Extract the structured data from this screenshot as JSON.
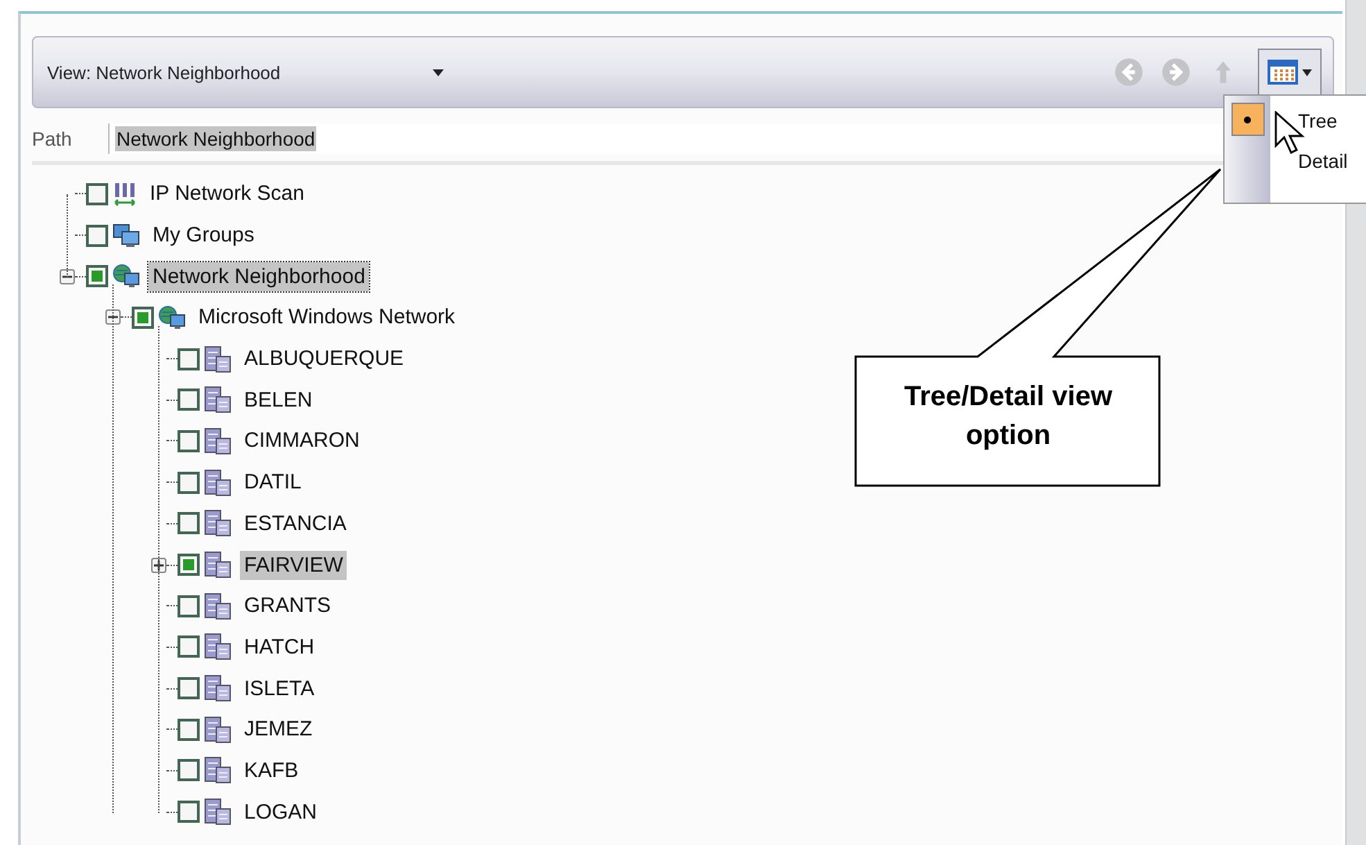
{
  "toolbar": {
    "view_label": "View: Network Neighborhood",
    "nav_buttons": [
      {
        "kind": "back",
        "disabled": true
      },
      {
        "kind": "forward",
        "disabled": true
      },
      {
        "kind": "up",
        "disabled": true
      }
    ],
    "view_menu": {
      "items": [
        {
          "label": "Tree",
          "selected": true
        },
        {
          "label": "Detail",
          "selected": false
        }
      ]
    }
  },
  "path": {
    "label": "Path",
    "value": "Network Neighborhood"
  },
  "tree": [
    {
      "label": "IP Network Scan",
      "kind": "scan",
      "checked": false,
      "selected": false
    },
    {
      "label": "My Groups",
      "kind": "groups",
      "checked": false,
      "selected": false
    },
    {
      "label": "Network Neighborhood",
      "kind": "network",
      "checked": true,
      "selected": true,
      "expanded": true,
      "children": [
        {
          "label": "Microsoft Windows Network",
          "kind": "network",
          "checked": true,
          "selected": false,
          "expanded": true,
          "children": [
            {
              "label": "ALBUQUERQUE",
              "kind": "server",
              "checked": false,
              "selected": false
            },
            {
              "label": "BELEN",
              "kind": "server",
              "checked": false,
              "selected": false
            },
            {
              "label": "CIMMARON",
              "kind": "server",
              "checked": false,
              "selected": false
            },
            {
              "label": "DATIL",
              "kind": "server",
              "checked": false,
              "selected": false
            },
            {
              "label": "ESTANCIA",
              "kind": "server",
              "checked": false,
              "selected": false
            },
            {
              "label": "FAIRVIEW",
              "kind": "server",
              "checked": true,
              "selected": true,
              "expanded": false
            },
            {
              "label": "GRANTS",
              "kind": "server",
              "checked": false,
              "selected": false
            },
            {
              "label": "HATCH",
              "kind": "server",
              "checked": false,
              "selected": false
            },
            {
              "label": "ISLETA",
              "kind": "server",
              "checked": false,
              "selected": false
            },
            {
              "label": "JEMEZ",
              "kind": "server",
              "checked": false,
              "selected": false
            },
            {
              "label": "KAFB",
              "kind": "server",
              "checked": false,
              "selected": false
            },
            {
              "label": "LOGAN",
              "kind": "server",
              "checked": false,
              "selected": false
            }
          ]
        }
      ]
    }
  ],
  "callout": {
    "text": "Tree/Detail view option"
  }
}
